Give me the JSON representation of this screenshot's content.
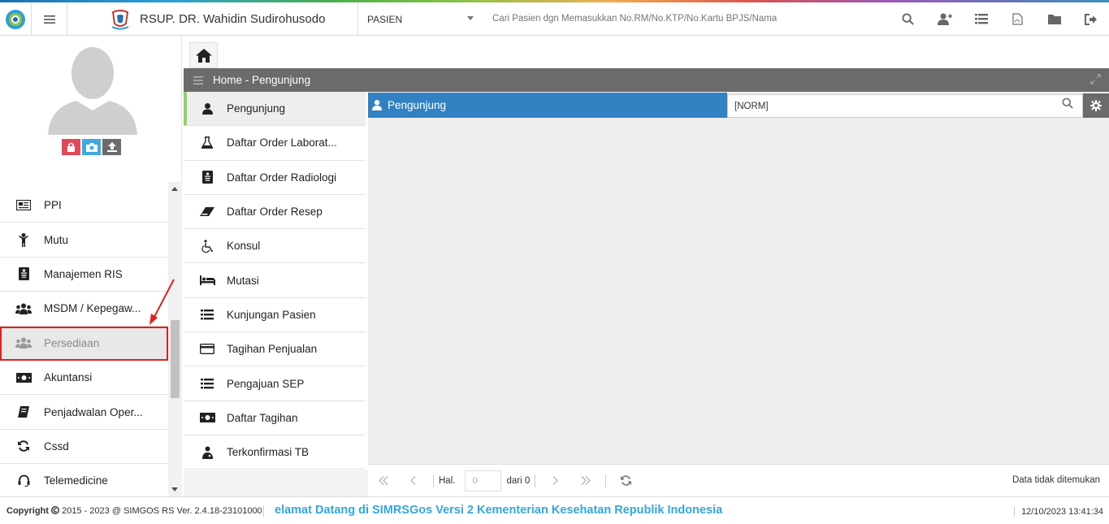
{
  "header": {
    "hospital_name": "RSUP. DR. Wahidin Sudirohusodo",
    "patient_type": "PASIEN",
    "search_placeholder": "Cari Pasien dgn Memasukkan No.RM/No.KTP/No.Kartu BPJS/Nama",
    "icons": [
      "search-icon",
      "add-user-icon",
      "list-icon",
      "pdf-icon",
      "folder-icon",
      "logout-icon"
    ]
  },
  "colors": {
    "panel_blue": "#3182c2",
    "crumb_gray": "#6c6a6a",
    "highlight_red": "#e0201a",
    "active_green": "#8fd36a",
    "marquee_blue": "#33a6e0"
  },
  "sidebar": {
    "items": [
      {
        "label": "PPI",
        "icon": "newspaper-icon"
      },
      {
        "label": "Mutu",
        "icon": "child-icon"
      },
      {
        "label": "Manajemen RIS",
        "icon": "xray-icon"
      },
      {
        "label": "MSDM / Kepegaw...",
        "icon": "users-icon"
      },
      {
        "label": "Persediaan",
        "icon": "users-icon"
      },
      {
        "label": "Akuntansi",
        "icon": "money-icon"
      },
      {
        "label": "Penjadwalan Oper...",
        "icon": "book-icon"
      },
      {
        "label": "Cssd",
        "icon": "refresh-icon"
      },
      {
        "label": "Telemedicine",
        "icon": "headset-icon"
      }
    ]
  },
  "breadcrumb": {
    "text": "Home - Pengunjung"
  },
  "submenu": {
    "items": [
      {
        "label": "Pengunjung",
        "icon": "user-icon"
      },
      {
        "label": "Daftar Order Laborat...",
        "icon": "flask-icon"
      },
      {
        "label": "Daftar Order Radiologi",
        "icon": "xray-icon"
      },
      {
        "label": "Daftar Order Resep",
        "icon": "eraser-icon"
      },
      {
        "label": "Konsul",
        "icon": "wheelchair-icon"
      },
      {
        "label": "Mutasi",
        "icon": "bed-icon"
      },
      {
        "label": "Kunjungan Pasien",
        "icon": "list-icon"
      },
      {
        "label": "Tagihan Penjualan",
        "icon": "credit-card-icon"
      },
      {
        "label": "Pengajuan SEP",
        "icon": "list-icon"
      },
      {
        "label": "Daftar Tagihan",
        "icon": "money-icon"
      },
      {
        "label": "Terkonfirmasi TB",
        "icon": "doctor-icon"
      }
    ]
  },
  "panel": {
    "title": "Pengunjung",
    "norm_value": "[NORM]"
  },
  "pager": {
    "hal_label": "Hal.",
    "page_value": "0",
    "of_label": "dari 0",
    "status": "Data tidak ditemukan"
  },
  "footer": {
    "copyright_label": "Copyright",
    "copyright_text": "2015 - 2023 @ SIMGOS RS Ver. 2.4.18-23101000",
    "marquee": "elamat Datang di SIMRSGos Versi 2 Kementerian Kesehatan Republik Indonesia",
    "datetime": "12/10/2023 13:41:34"
  }
}
